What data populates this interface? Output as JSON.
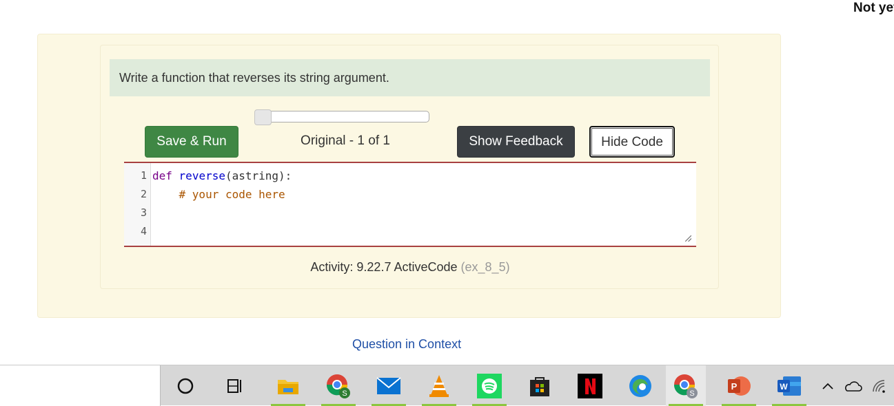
{
  "status": {
    "top_right_text": "Not yet"
  },
  "question": {
    "prompt": "Write a function that reverses its string argument."
  },
  "history_slider": {
    "position_fraction": 0.0
  },
  "toolbar": {
    "save_run_label": "Save & Run",
    "version_label": "Original - 1 of 1",
    "show_feedback_label": "Show Feedback",
    "hide_code_label": "Hide Code"
  },
  "editor": {
    "line_numbers": [
      "1",
      "2",
      "3",
      "4"
    ],
    "lines": {
      "l1_keyword": "def",
      "l1_space": " ",
      "l1_name": "reverse",
      "l1_rest": "(astring):",
      "l2_indent": "    ",
      "l2_comment": "# your code here"
    }
  },
  "activity": {
    "label": "Activity: 9.22.7 ActiveCode",
    "id": "(ex_8_5)"
  },
  "links": {
    "question_in_context": "Question in Context"
  },
  "taskbar": {
    "items": [
      "search-circle-icon",
      "task-view-icon",
      "file-explorer-icon",
      "chrome-icon",
      "mail-icon",
      "vlc-icon",
      "spotify-icon",
      "store-icon",
      "netflix-icon",
      "edge-icon",
      "chrome-profile-icon",
      "powerpoint-icon",
      "word-icon"
    ],
    "tray": [
      "chevron-up-icon",
      "onedrive-cloud-icon",
      "wifi-icon"
    ]
  },
  "colors": {
    "panel_bg": "#fcf8e3",
    "question_bg": "#dfebdb",
    "save_button": "#3f8744",
    "feedback_button": "#3b3f43",
    "editor_border": "#a84040",
    "link": "#1f4fa6"
  }
}
